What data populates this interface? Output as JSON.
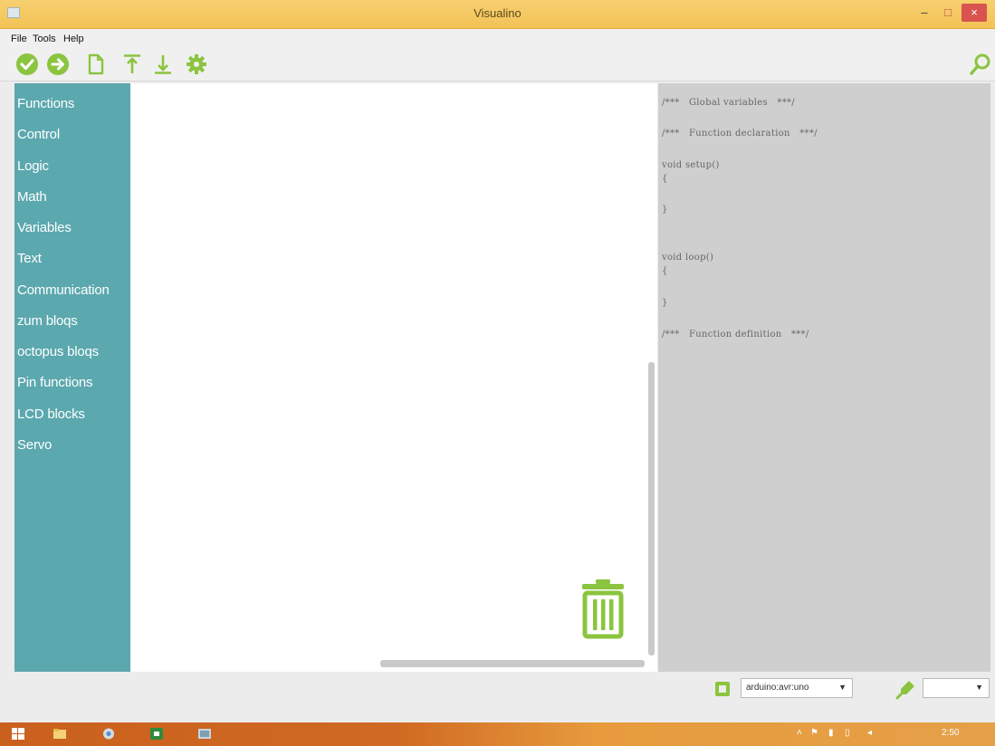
{
  "window": {
    "title": "Visualino",
    "minimize": "–",
    "maximize": "□",
    "close": "×"
  },
  "menu": {
    "file": "File",
    "tools": "Tools",
    "help": "Help"
  },
  "toolbar": {
    "icons": [
      "check-icon",
      "arrow-right-icon",
      "new-file-icon",
      "upload-icon",
      "download-icon",
      "gear-icon",
      "search-icon"
    ],
    "accent": "#8bc43f"
  },
  "categories": [
    "Functions",
    "Control",
    "Logic",
    "Math",
    "Variables",
    "Text",
    "Communication",
    "zum bloqs",
    "octopus bloqs",
    "Pin functions",
    "LCD blocks",
    "Servo"
  ],
  "code": [
    "/***   Global variables   ***/",
    "/***   Function declaration   ***/",
    "void setup()",
    "{",
    "}",
    "void loop()",
    "{",
    "}",
    "/***   Function definition   ***/"
  ],
  "bottom": {
    "board": "arduino:avr:uno",
    "port": ""
  },
  "taskbar": {
    "clock": "2:50"
  },
  "colors": {
    "sidebar": "#5ba8ae",
    "accent": "#8bc43f",
    "titlebar": "#f3c257",
    "codepanel": "#cfcfcf"
  }
}
